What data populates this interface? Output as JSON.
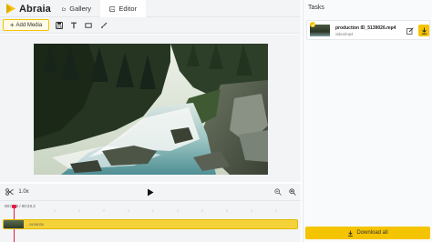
{
  "app": {
    "name": "Abraia",
    "brand_color": "#f5c400",
    "accent_red": "#e11d48"
  },
  "nav": {
    "tabs": [
      {
        "label": "Gallery",
        "icon": "folder-icon"
      },
      {
        "label": "Editor",
        "icon": "edit-image-icon"
      }
    ]
  },
  "toolbar": {
    "add_media_label": "Add Media",
    "tools": [
      "save-icon",
      "text-icon",
      "rectangle-icon",
      "brush-icon"
    ]
  },
  "controls": {
    "speed": "1.0x",
    "icons": [
      "scissors-icon",
      "play-icon",
      "zoom-out-icon",
      "zoom-in-icon"
    ]
  },
  "timeline": {
    "time_display": "00:00.6 / 00:23.2",
    "clip_label": "...5139026"
  },
  "tasks": {
    "title": "Tasks",
    "items": [
      {
        "name": "production ID_5139026.mp4",
        "type": "video/mp4",
        "status": "done"
      }
    ],
    "download_all_label": "Download all"
  }
}
